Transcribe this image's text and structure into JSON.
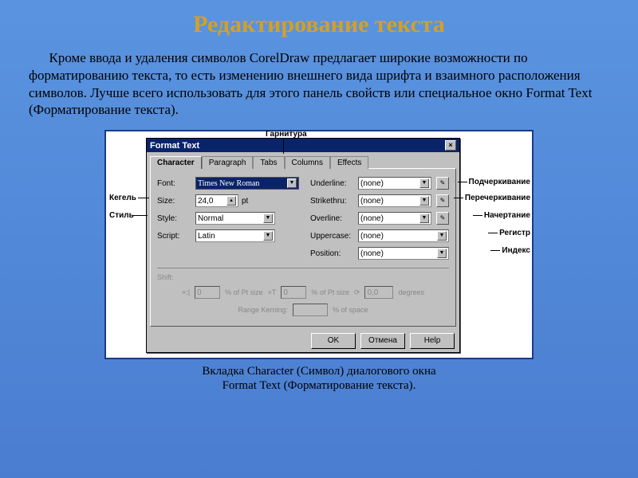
{
  "slide": {
    "title": "Редактирование текста",
    "paragraph": "Кроме ввода и удаления символов CorelDraw  предлагает широкие возможности по форматированию текста, то есть изменению внешнего вида шрифта и взаимного расположения символов. Лучше всего использовать для этого панель свойств или специальное окно Format Text (Форматирование текста).",
    "caption_line1": "Вкладка Character (Символ) диалогового окна",
    "caption_line2": "Format Text (Форматирование текста)."
  },
  "dialog": {
    "title": "Format Text",
    "tabs": [
      "Character",
      "Paragraph",
      "Tabs",
      "Columns",
      "Effects"
    ],
    "active_tab": "Character",
    "left": {
      "font_label": "Font:",
      "font_value": "Times New Roman",
      "size_label": "Size:",
      "size_value": "24,0",
      "size_unit": "pt",
      "style_label": "Style:",
      "style_value": "Normal",
      "script_label": "Script:",
      "script_value": "Latin"
    },
    "right": {
      "underline_label": "Underline:",
      "underline_value": "(none)",
      "strikethru_label": "Strikethru:",
      "strikethru_value": "(none)",
      "overline_label": "Overline:",
      "overline_value": "(none)",
      "uppercase_label": "Uppercase:",
      "uppercase_value": "(none)",
      "position_label": "Position:",
      "position_value": "(none)"
    },
    "disabled": {
      "shift_label": "Shift:",
      "pt_size_1": "% of Pt size",
      "pt_size_2": "% of Pt size",
      "degrees": "degrees",
      "range_kerning": "Range Kerning:",
      "of_space": "% of space",
      "val0a": "0",
      "val0b": "0",
      "val0c": "0,0"
    },
    "buttons": {
      "ok": "OK",
      "cancel": "Отмена",
      "help": "Help"
    }
  },
  "annotations": {
    "top": "Гарнитура",
    "left_size": "Кегель",
    "left_style": "Стиль",
    "r1": "Подчеркивание",
    "r2": "Перечеркивание",
    "r3": "Начертание",
    "r4": "Регистр",
    "r5": "Индекс"
  }
}
